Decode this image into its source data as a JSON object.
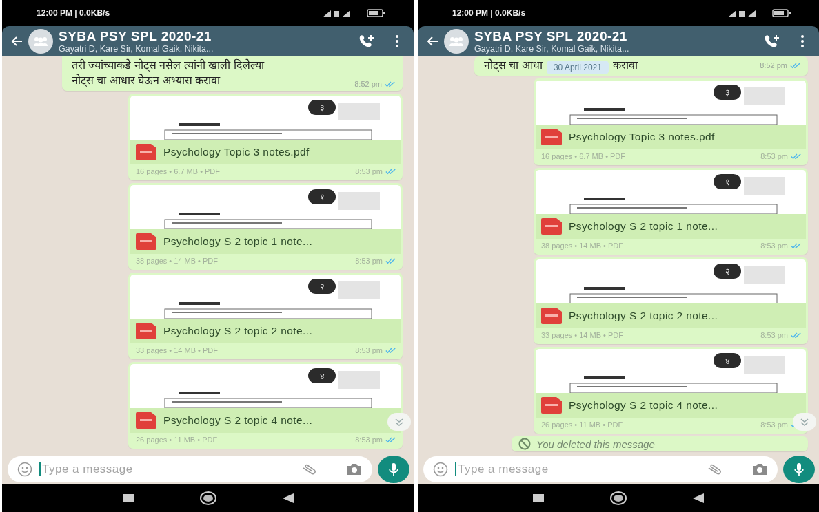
{
  "phones": [
    {
      "status_bar": {
        "text": "12:00 PM | 0.0KB/s"
      },
      "header": {
        "title": "SYBA PSY SPL 2020-21",
        "subtitle": "Gayatri D, Kare Sir, Komal Gaik, Nikita..."
      },
      "messages": [
        {
          "kind": "text",
          "lines": [
            "तरी ज्यांच्याकडे नोट्स नसेल त्यांनी खाली दिलेल्या",
            "नोट्स चा आधार घेऊन अभ्यास करावा"
          ],
          "time": "8:52 pm",
          "read": true
        },
        {
          "kind": "document",
          "badge": "३",
          "name": "Psychology Topic 3 notes.pdf",
          "meta": "16 pages • 6.7 MB • PDF",
          "time": "8:53 pm",
          "read": true
        },
        {
          "kind": "document",
          "badge": "१",
          "name": "Psychology S 2 topic 1 note...",
          "meta": "38 pages • 14 MB • PDF",
          "time": "8:53 pm",
          "read": true
        },
        {
          "kind": "document",
          "badge": "२",
          "name": "Psychology S 2 topic 2 note...",
          "meta": "33 pages • 14 MB • PDF",
          "time": "8:53 pm",
          "read": true
        },
        {
          "kind": "document",
          "badge": "४",
          "name": "Psychology S 2 topic 4 note...",
          "meta": "26 pages • 11 MB • PDF",
          "time": "8:53 pm",
          "read": true
        }
      ],
      "input": {
        "placeholder": "Type a message"
      }
    },
    {
      "status_bar": {
        "text": "12:00 PM | 0.0KB/s"
      },
      "header": {
        "title": "SYBA PSY SPL 2020-21",
        "subtitle": "Gayatri D, Kare Sir, Komal Gaik, Nikita..."
      },
      "messages": [
        {
          "kind": "text_covered",
          "parts": [
            "नोट्स चा आधा",
            "करावा"
          ],
          "date_chip": "30 April 2021",
          "time": "8:52 pm",
          "read": true
        },
        {
          "kind": "document",
          "badge": "३",
          "name": "Psychology Topic 3 notes.pdf",
          "meta": "16 pages • 6.7 MB • PDF",
          "time": "8:53 pm",
          "read": true
        },
        {
          "kind": "document",
          "badge": "१",
          "name": "Psychology S 2 topic 1 note...",
          "meta": "38 pages • 14 MB • PDF",
          "time": "8:53 pm",
          "read": true
        },
        {
          "kind": "document",
          "badge": "२",
          "name": "Psychology S 2 topic 2 note...",
          "meta": "33 pages • 14 MB • PDF",
          "time": "8:53 pm",
          "read": true
        },
        {
          "kind": "document",
          "badge": "४",
          "name": "Psychology S 2 topic 4 note...",
          "meta": "26 pages • 11 MB • PDF",
          "time": "8:53 pm",
          "read": true
        },
        {
          "kind": "deleted",
          "text": "You deleted this message"
        }
      ],
      "input": {
        "placeholder": "Type a message"
      }
    }
  ]
}
